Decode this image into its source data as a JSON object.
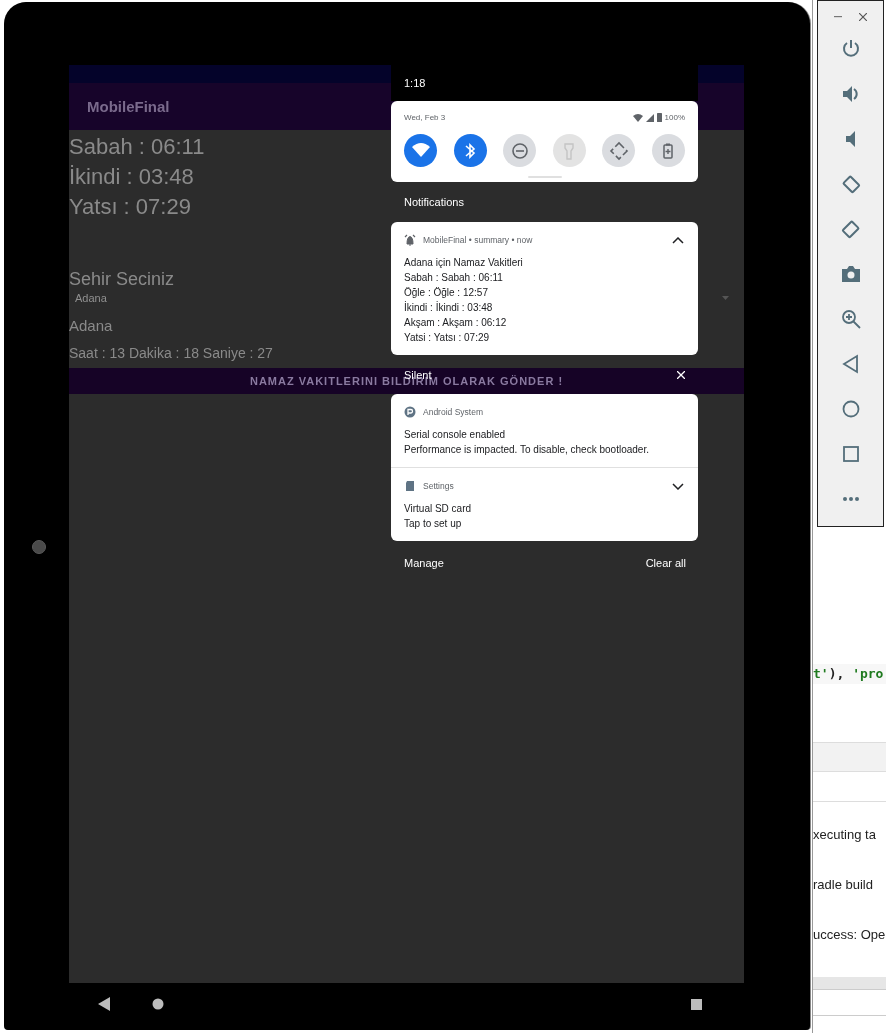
{
  "device": {
    "app": {
      "title": "MobileFinal",
      "prayer_times": [
        "Sabah : 06:11",
        "İkindi : 03:48",
        "Yatsı : 07:29"
      ],
      "city_label": "Sehir Seciniz",
      "city_dropdown": {
        "value": "Adana"
      },
      "selected_city": "Adana",
      "clock": "Saat : 13 Dakika : 18 Saniye : 27",
      "send_button": "NAMAZ VAKITLERINI BILDIRIM OLARAK GÖNDER !"
    },
    "shade": {
      "time": "1:18",
      "date": "Wed, Feb 3",
      "battery": "100%",
      "tiles": [
        {
          "kind": "wifi",
          "on": true,
          "disabled": false
        },
        {
          "kind": "bluetooth",
          "on": true,
          "disabled": false
        },
        {
          "kind": "dnd",
          "on": false,
          "disabled": false
        },
        {
          "kind": "flashlight",
          "on": false,
          "disabled": true
        },
        {
          "kind": "rotate",
          "on": false,
          "disabled": false
        },
        {
          "kind": "battery",
          "on": false,
          "disabled": false
        }
      ],
      "notifications_header": "Notifications",
      "notifications": [
        {
          "kind": "alarm",
          "header": "MobileFinal • summary • now",
          "expanded": true,
          "lines": [
            "Adana için Namaz Vakitleri",
            "Sabah : Sabah : 06:11",
            "Öğle : Öğle : 12:57",
            "İkindi : İkindi : 03:48",
            "Akşam : Akşam : 06:12",
            "Yatsi : Yatsı : 07:29"
          ]
        }
      ],
      "silent": {
        "label": "Silent",
        "notifications": [
          {
            "kind": "system",
            "header": "Android System",
            "lines": [
              "Serial console enabled",
              "Performance is impacted. To disable, check bootloader."
            ]
          },
          {
            "kind": "sdcard",
            "header": "Settings",
            "expanded": false,
            "lines": [
              "Virtual SD card",
              "Tap to set up"
            ]
          }
        ]
      },
      "footer": {
        "manage": "Manage",
        "clear_all": "Clear all"
      }
    }
  },
  "ide": {
    "code_tokens": [
      {
        "text": "t'",
        "kind": "string"
      },
      {
        "text": "), ",
        "kind": "plain"
      },
      {
        "text": "'pro",
        "kind": "string"
      }
    ],
    "log_lines": [
      "xecuting ta",
      "radle build",
      "uccess: Ope"
    ]
  }
}
